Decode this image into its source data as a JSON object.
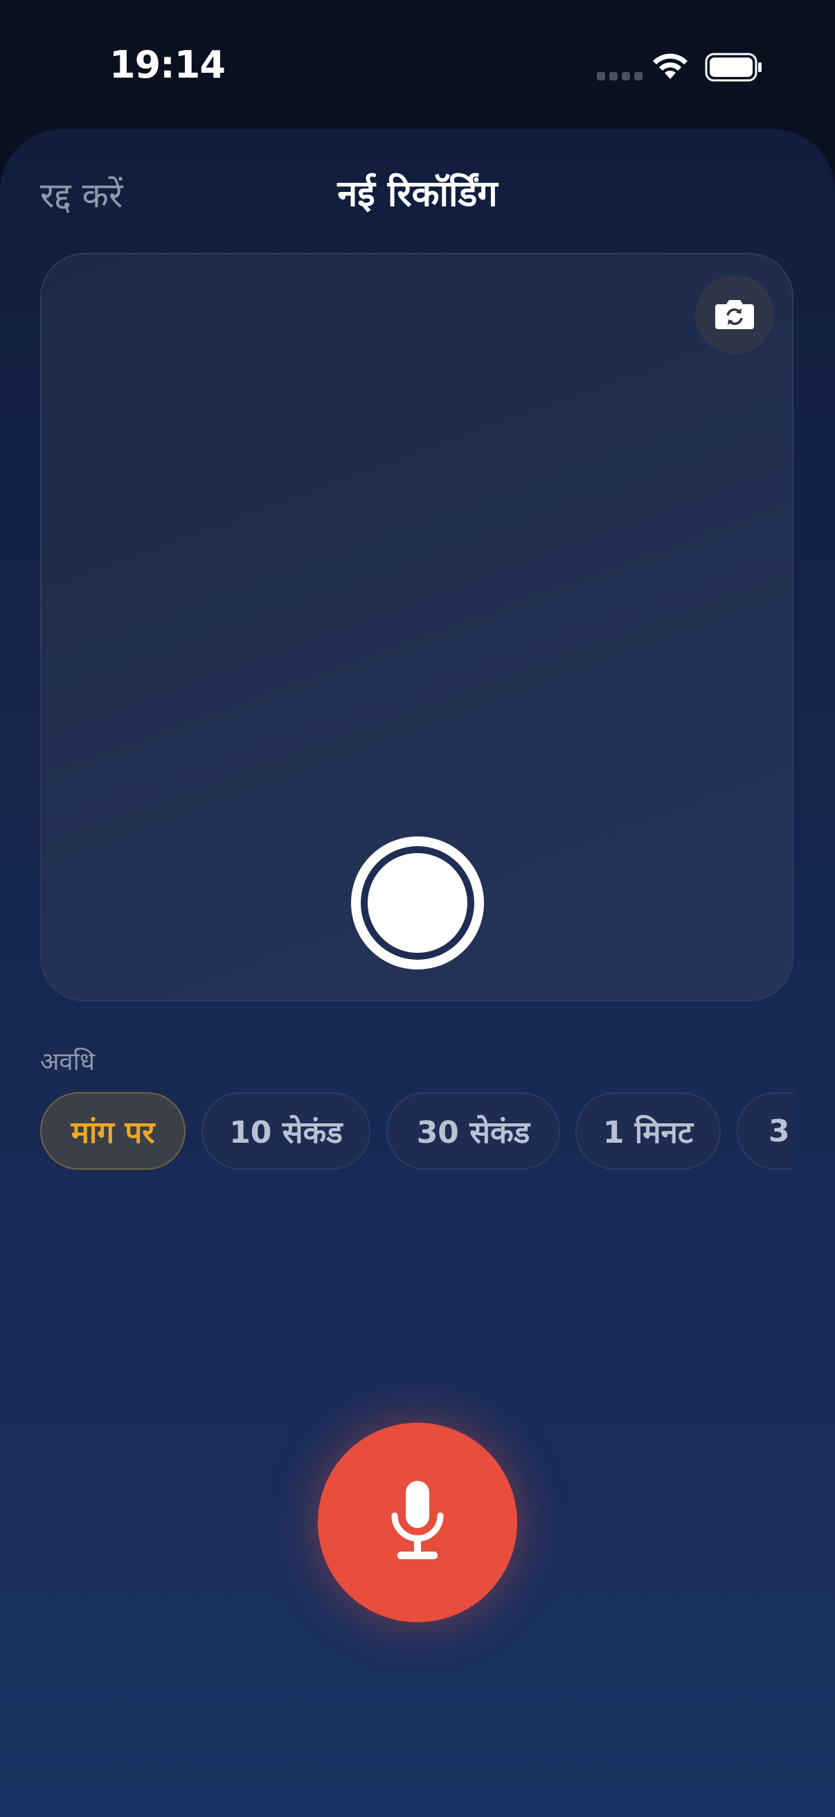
{
  "status_bar": {
    "time": "19:14"
  },
  "header": {
    "cancel_label": "रद्द करें",
    "title": "नई रिकॉर्डिंग"
  },
  "duration": {
    "label": "अवधि",
    "options": [
      "मांग पर",
      "10 सेकंड",
      "30 सेकंड",
      "1 मिनट",
      "3"
    ],
    "selected_index": 0
  },
  "icons": {
    "flip_camera": "camera-flip-icon",
    "shutter": "shutter-icon",
    "microphone": "microphone-icon",
    "wifi": "wifi-icon",
    "battery": "battery-icon",
    "signal": "signal-icon"
  },
  "colors": {
    "accent": "#e84e3d",
    "selected_chip_text": "#f0a823"
  }
}
